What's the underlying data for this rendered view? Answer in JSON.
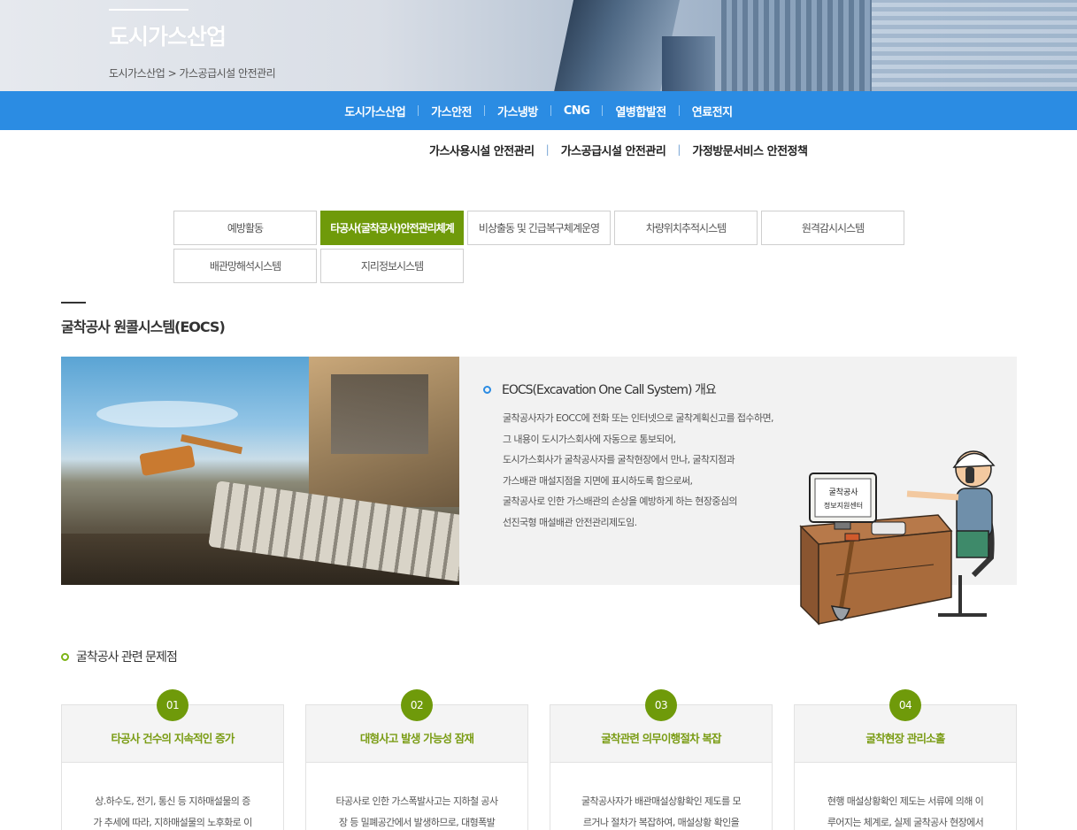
{
  "header": {
    "title": "도시가스산업",
    "breadcrumb": [
      "도시가스산업",
      "가스공급시설 안전관리"
    ],
    "breadcrumb_separator": ">"
  },
  "main_nav": {
    "items": [
      {
        "label": "도시가스산업"
      },
      {
        "label": "가스안전"
      },
      {
        "label": "가스냉방"
      },
      {
        "label": "CNG"
      },
      {
        "label": "열병합발전"
      },
      {
        "label": "연료전지"
      }
    ]
  },
  "sub_nav": {
    "items": [
      {
        "label": "가스사용시설 안전관리"
      },
      {
        "label": "가스공급시설 안전관리"
      },
      {
        "label": "가정방문서비스 안전정책"
      }
    ],
    "separator": "|"
  },
  "tabs": [
    {
      "label": "예방활동",
      "active": false
    },
    {
      "label": "타공사(굴착공사)안전관리체계",
      "active": true
    },
    {
      "label": "비상출동 및 긴급복구체계운영",
      "active": false
    },
    {
      "label": "차량위치추적시스템",
      "active": false
    },
    {
      "label": "원격감시시스템",
      "active": false
    },
    {
      "label": "배관망해석시스템",
      "active": false
    },
    {
      "label": "지리정보시스템",
      "active": false
    }
  ],
  "section": {
    "title": "굴착공사 원콜시스템(EOCS)"
  },
  "eocs": {
    "title": "EOCS(Excavation One Call System) 개요",
    "lines": [
      "굴착공사자가 EOCC에 전화 또는 인터넷으로 굴착계획신고를 접수하면,",
      "그 내용이 도시가스회사에 자동으로 통보되어,",
      "도시가스회사가 굴착공사자를 굴착현장에서 만나, 굴착지점과",
      "가스배관 매설지점을 지면에 표시하도록 함으로써,",
      "굴착공사로 인한 가스배관의 손상을 예방하게 하는 현장중심의",
      "선진국형 매설배관 안전관리제도임."
    ],
    "illustration_sign": [
      "굴착공사",
      "정보지원센터"
    ]
  },
  "problems": {
    "title": "굴착공사 관련 문제점",
    "cards": [
      {
        "num": "01",
        "title": "타공사 건수의 지속적인 증가",
        "lines": [
          "상.하수도, 전기, 통신 등 지하매설물의 증",
          "가 추세에 따라, 지하매설물의 노후화로 이"
        ]
      },
      {
        "num": "02",
        "title": "대형사고 발생 가능성 잠재",
        "lines": [
          "타공사로 인한 가스폭발사고는 지하철 공사",
          "장 등 밀폐공간에서 발생하므로, 대형폭발"
        ]
      },
      {
        "num": "03",
        "title": "굴착관련 의무이행절차 복잡",
        "lines": [
          "굴착공사자가 배관매설상황확인 제도를 모",
          "르거나 절차가 복잡하여, 매설상황 확인을"
        ]
      },
      {
        "num": "04",
        "title": "굴착현장 관리소홀",
        "lines": [
          "현행 매설상황확인 제도는 서류에 의해 이",
          "루어지는 체계로, 실제 굴착공사 현장에서"
        ]
      }
    ]
  },
  "colors": {
    "nav_blue": "#2b8ce3",
    "accent_green": "#6f9a0a",
    "card_title_green": "#7a9c14"
  }
}
